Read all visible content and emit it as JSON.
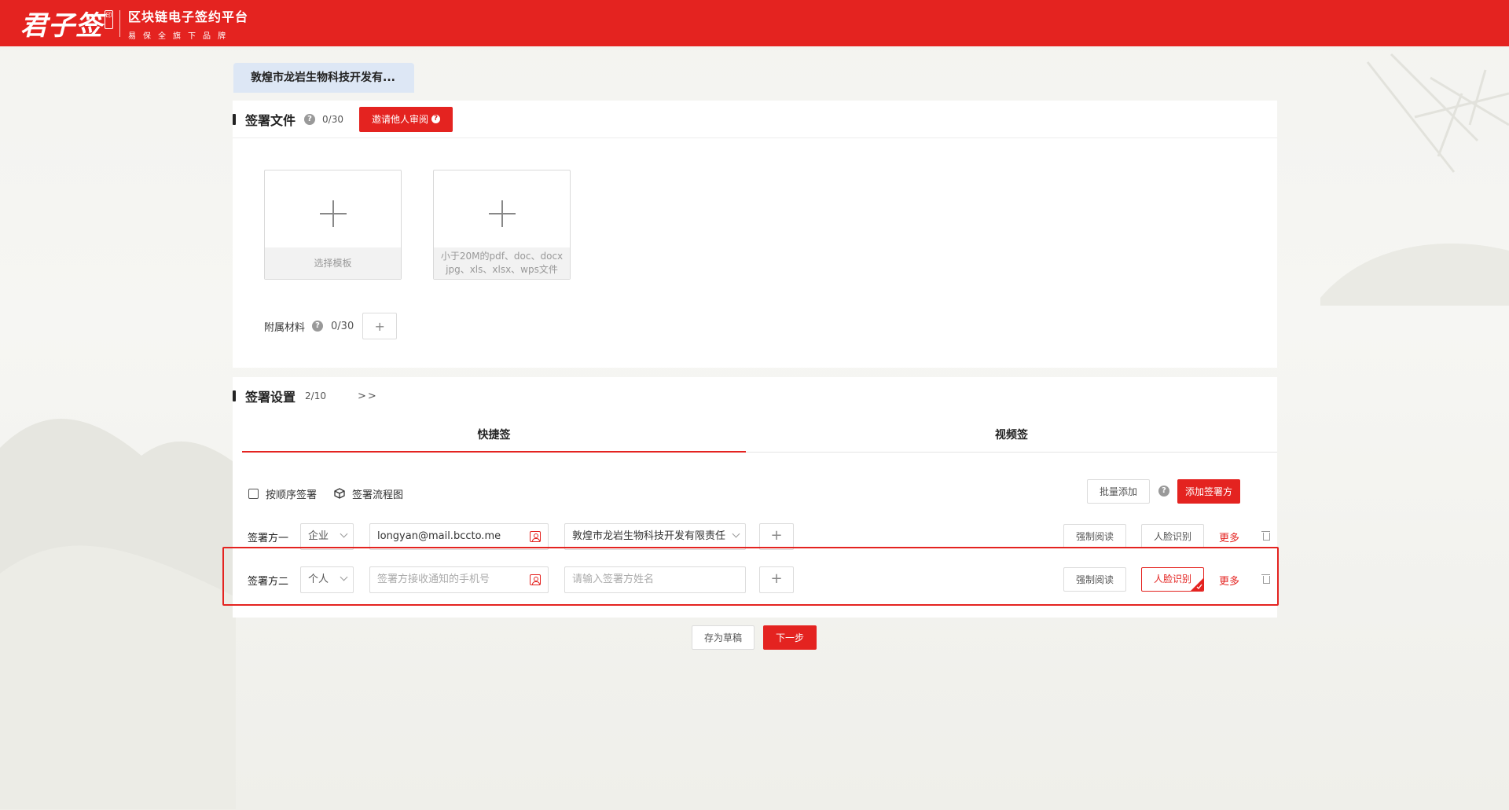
{
  "brand": {
    "logo": "君子签",
    "seal": "印",
    "platform": "区块链电子签约平台",
    "tagline": "易保全旗下品牌"
  },
  "company_tab": "敦煌市龙岩生物科技开发有...",
  "sign_files": {
    "title": "签署文件",
    "help": "?",
    "count": "0/30",
    "invite_label": "邀请他人审阅",
    "template_caption": "选择模板",
    "upload_caption_1": "小于20M的pdf、doc、docx",
    "upload_caption_2": "jpg、xls、xlsx、wps文件",
    "attach_label": "附属材料",
    "attach_count": "0/30",
    "attach_add": "+"
  },
  "sign_settings": {
    "title": "签署设置",
    "count": "2/10",
    "expand": ">>",
    "tabs": [
      "快捷签",
      "视频签"
    ],
    "active_tab": 0,
    "order_label": "按顺序签署",
    "flow_label": "签署流程图",
    "batch_add": "批量添加",
    "add_party": "添加签署方",
    "parties": [
      {
        "label": "签署方一",
        "type": "企业",
        "contact": "longyan@mail.bccto.me",
        "name": "敦煌市龙岩生物科技开发有限责任",
        "add": "+",
        "force_read": "强制阅读",
        "face": "人脸识别",
        "more": "更多"
      },
      {
        "label": "签署方二",
        "type": "个人",
        "contact_placeholder": "签署方接收通知的手机号",
        "name_placeholder": "请输入签署方姓名",
        "add": "+",
        "force_read": "强制阅读",
        "face": "人脸识别",
        "more": "更多"
      }
    ]
  },
  "footer": {
    "save_draft": "存为草稿",
    "next": "下一步"
  },
  "colors": {
    "brand_red": "#e42320",
    "tab_blue": "#dde7f5"
  }
}
